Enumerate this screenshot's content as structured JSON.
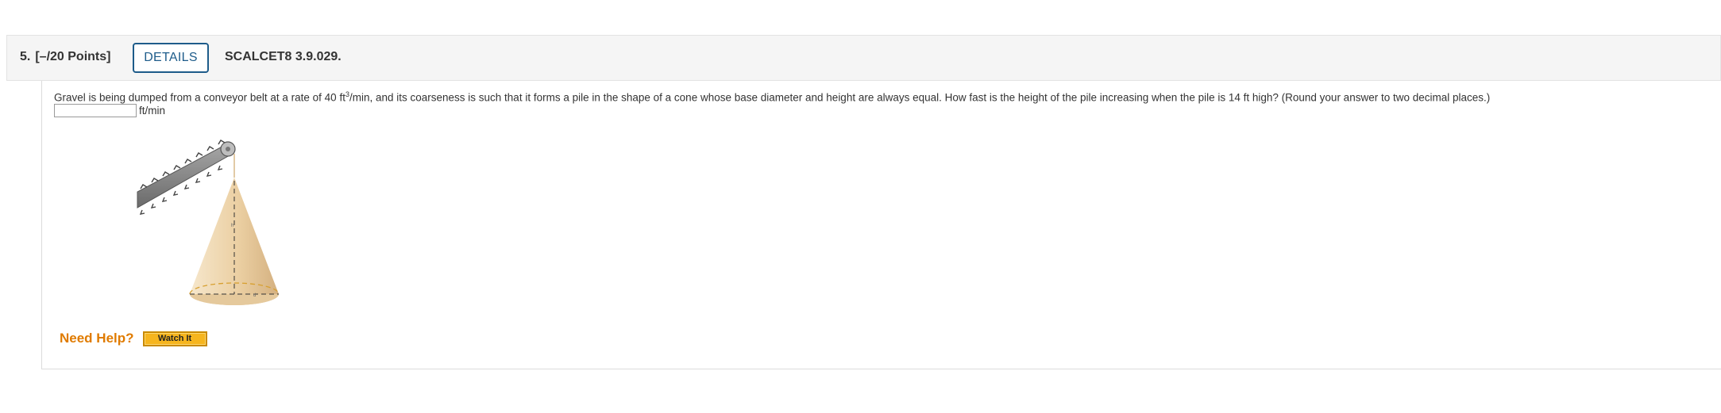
{
  "question": {
    "number": "5.",
    "points": "[–/20 Points]",
    "details_label": "DETAILS",
    "id": "SCALCET8 3.9.029."
  },
  "prompt": {
    "part1": "Gravel is being dumped from a conveyor belt at a rate of 40 ft",
    "exponent": "3",
    "part2": "/min, and its coarseness is such that it forms a pile in the shape of a cone whose base diameter and height are always equal. How fast is the height of the pile increasing when the pile is 14 ft high? (Round your answer to two decimal places.)"
  },
  "answer": {
    "value": "",
    "placeholder": "",
    "unit": "ft/min"
  },
  "figure": {
    "height_label": "h",
    "diameter_label": "d",
    "colors": {
      "cone_light": "#f3e0bf",
      "cone_dark": "#d9b888",
      "belt": "#8c8c8c",
      "dashed_base": "#d7a030"
    }
  },
  "help": {
    "label": "Need Help?",
    "watch_label": "Watch It"
  },
  "colors": {
    "accent_blue": "#1e5c8a",
    "help_orange": "#e07b00",
    "watch_yellow": "#f6b51e"
  }
}
